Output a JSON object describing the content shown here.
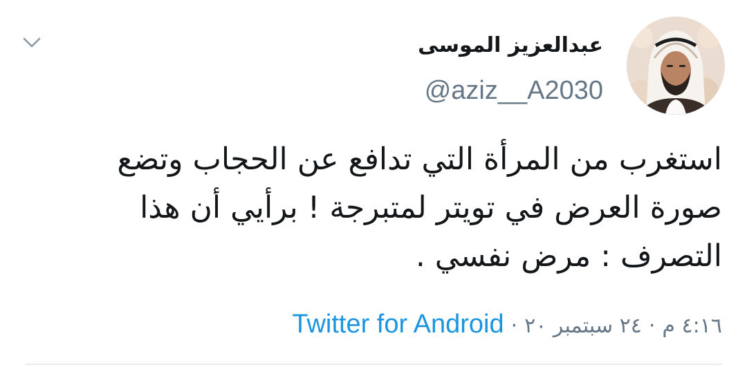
{
  "author": {
    "display_name": "عبدالعزيز الموسى",
    "handle": "@aziz__A2030"
  },
  "tweet": {
    "lines": [
      "استغرب من المرأة التي تدافع عن الحجاب وتضع",
      "صورة العرض في تويتر لمتبرجة ! برأيي أن هذا",
      "التصرف : مرض نفسي ."
    ]
  },
  "meta": {
    "time": "٤:١٦ م",
    "separator": "·",
    "date": "٢٤ سبتمبر ٢٠",
    "source": "Twitter for Android"
  },
  "icons": {
    "menu": "chevron-down-icon"
  },
  "colors": {
    "text": "#14171a",
    "secondary": "#657786",
    "link": "#1b95e0",
    "divider": "#e6ecf0"
  }
}
